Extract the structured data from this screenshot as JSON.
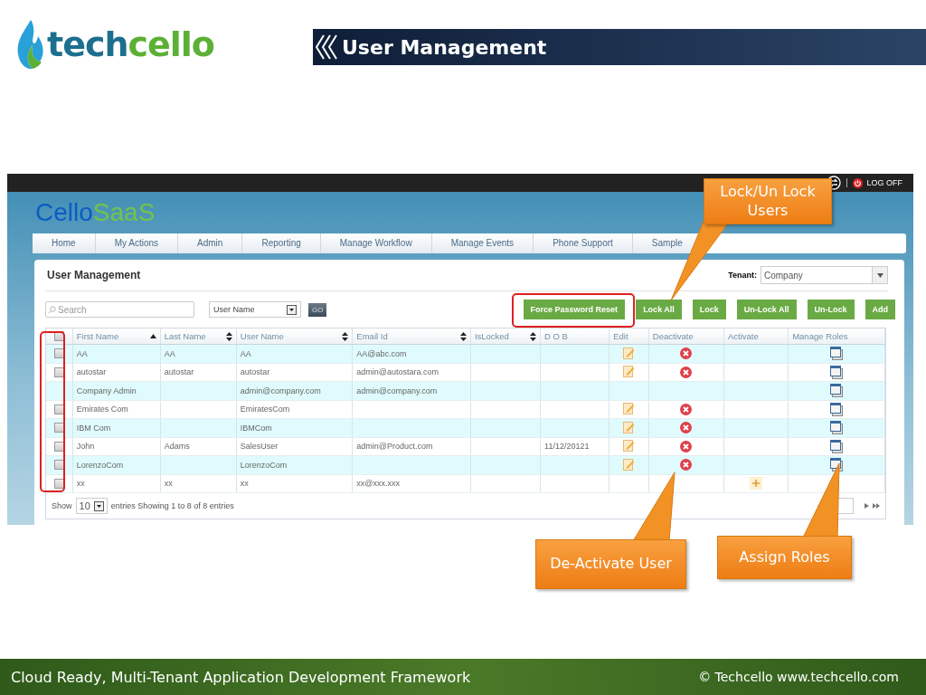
{
  "slide": {
    "brand": [
      {
        "text": "tech",
        "color": "#1d6f8f"
      },
      {
        "text": "cello",
        "color": "#5cb035"
      }
    ],
    "title": "User Management",
    "footer_left": "Cloud Ready, Multi-Tenant Application Development Framework",
    "footer_right": "© Techcello www.techcello.com"
  },
  "app": {
    "logo": [
      {
        "text": "Cello",
        "color": "#0b5cc4"
      },
      {
        "text": "SaaS",
        "color": "#72c447"
      }
    ],
    "logoff": "LOG OFF",
    "nav": [
      {
        "label": "Home",
        "selected": false
      },
      {
        "label": "My Actions",
        "selected": false
      },
      {
        "label": "Admin",
        "selected": false
      },
      {
        "label": "Reporting",
        "selected": false
      },
      {
        "label": "Manage Workflow",
        "selected": false
      },
      {
        "label": "Manage Events",
        "selected": false
      },
      {
        "label": "Phone Support",
        "selected": false
      },
      {
        "label": "Sample",
        "selected": false
      }
    ],
    "page_title": "User Management",
    "search": {
      "placeholder": "Search"
    },
    "filter": {
      "value": "User Name"
    },
    "go": "GO",
    "tenant": {
      "label": "Tenant:",
      "value": "Company"
    },
    "buttons": [
      {
        "label": "Force Password Reset"
      },
      {
        "label": "Lock All"
      },
      {
        "label": "Lock"
      },
      {
        "label": "Un-Lock All"
      },
      {
        "label": "Un-Lock"
      },
      {
        "label": "Add"
      }
    ],
    "table": {
      "header_checked": false,
      "columns": [
        {
          "label": "First Name",
          "kind": "sorted"
        },
        {
          "label": "Last Name",
          "kind": "sortable"
        },
        {
          "label": "User Name",
          "kind": "sortable"
        },
        {
          "label": "Email Id",
          "kind": "sortable"
        },
        {
          "label": "IsLocked",
          "kind": "sortable"
        },
        {
          "label": "D O B",
          "kind": "plain"
        },
        {
          "label": "Edit",
          "kind": "plain"
        },
        {
          "label": "Deactivate",
          "kind": "plain"
        },
        {
          "label": "Activate",
          "kind": "plain"
        },
        {
          "label": "Manage Roles",
          "kind": "plain"
        }
      ],
      "rows": [
        {
          "checkbox": true,
          "checked": false,
          "first": "AA",
          "last": "AA",
          "user": "AA",
          "email": "AA@abc.com",
          "edit": true,
          "deactivate": true,
          "activate": false,
          "roles": true
        },
        {
          "checkbox": true,
          "checked": false,
          "first": "autostar",
          "last": "autostar",
          "user": "autostar",
          "email": "admin@autostara.com",
          "edit": true,
          "deactivate": true,
          "activate": false,
          "roles": true
        },
        {
          "checkbox": false,
          "first": "Company Admin",
          "user": "admin@company.com",
          "email": "admin@company.com",
          "edit": false,
          "deactivate": false,
          "activate": false,
          "roles": true
        },
        {
          "checkbox": true,
          "checked": false,
          "first": "Emirates Com",
          "user": "EmiratesCom",
          "edit": true,
          "deactivate": true,
          "activate": false,
          "roles": true
        },
        {
          "checkbox": true,
          "checked": false,
          "first": "IBM Com",
          "user": "IBMCom",
          "edit": true,
          "deactivate": true,
          "activate": false,
          "roles": true
        },
        {
          "checkbox": true,
          "checked": false,
          "first": "John",
          "last": "Adams",
          "user": "SalesUser",
          "email": "admin@Product.com",
          "dob": "11/12/20121",
          "edit": true,
          "deactivate": true,
          "activate": false,
          "roles": true
        },
        {
          "checkbox": true,
          "checked": false,
          "first": "LorenzoCom",
          "user": "LorenzoCom",
          "edit": true,
          "deactivate": true,
          "activate": false,
          "roles": true
        },
        {
          "checkbox": true,
          "checked": false,
          "first": "xx",
          "last": "xx",
          "user": "xx",
          "email": "xx@xxx.xxx",
          "edit": false,
          "deactivate": false,
          "activate": true,
          "roles": false
        }
      ]
    },
    "pager": {
      "show": "Show",
      "page_size": "10",
      "info": "entries Showing 1 to 8 of 8 entries"
    }
  },
  "callouts": [
    {
      "text": "Lock/Un Lock Users"
    },
    {
      "text": "De-Activate User"
    },
    {
      "text": "Assign Roles"
    }
  ]
}
